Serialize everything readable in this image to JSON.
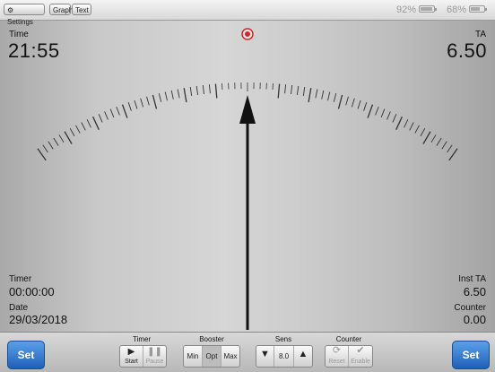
{
  "topbar": {
    "settings_label": "Settings",
    "graph_label": "Graph",
    "text_label": "Text",
    "battery1_text": "92%",
    "battery1_level": 0.92,
    "battery2_text": "68%",
    "battery2_level": 0.68
  },
  "readouts": {
    "time_label": "Time",
    "time_value": "21:55",
    "ta_label": "TA",
    "ta_value": "6.50",
    "timer_label": "Timer",
    "timer_value": "00:00:00",
    "date_label": "Date",
    "date_value": "29/03/2018",
    "inst_ta_label": "Inst TA",
    "inst_ta_value": "6.50",
    "counter_label": "Counter",
    "counter_value": "0.00"
  },
  "gauge": {
    "needle_position": 0.5
  },
  "controls": {
    "set_left_label": "Set",
    "set_right_label": "Set",
    "timer_title": "Timer",
    "start_label": "Start",
    "pause_label": "Pause",
    "booster_title": "Booster",
    "booster_options": [
      "Min",
      "Opt",
      "Max"
    ],
    "booster_selected": "Opt",
    "sens_title": "Sens",
    "sens_value": "8.0",
    "counter_title": "Counter",
    "reset_label": "Reset",
    "enable_label": "Enable"
  },
  "colors": {
    "set_button": "#2a6fc9",
    "record_indicator": "#cc2a2a"
  }
}
